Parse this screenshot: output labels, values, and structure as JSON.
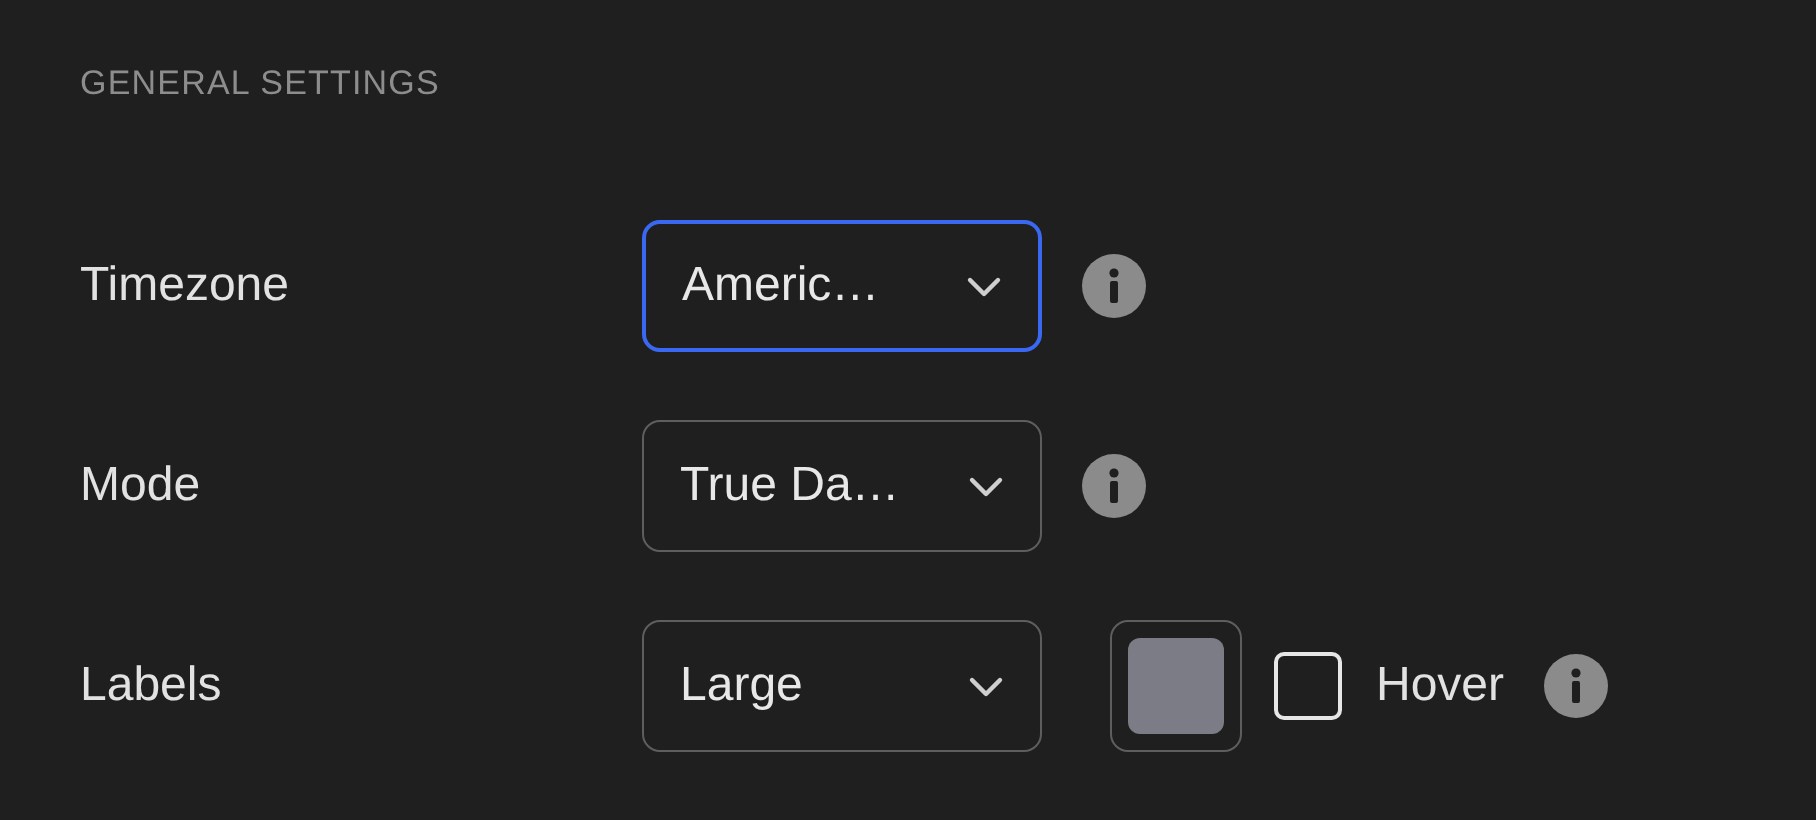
{
  "section_title": "GENERAL SETTINGS",
  "rows": [
    {
      "label": "Timezone",
      "select": {
        "value": "Americ…",
        "focused": true
      },
      "info": true
    },
    {
      "label": "Mode",
      "select": {
        "value": "True Da…",
        "focused": false
      },
      "info": true
    },
    {
      "label": "Labels",
      "select": {
        "value": "Large",
        "focused": false
      },
      "swatch": {
        "color": "#7b7c86"
      },
      "checkbox": {
        "label": "Hover",
        "checked": false
      },
      "info": true
    }
  ]
}
